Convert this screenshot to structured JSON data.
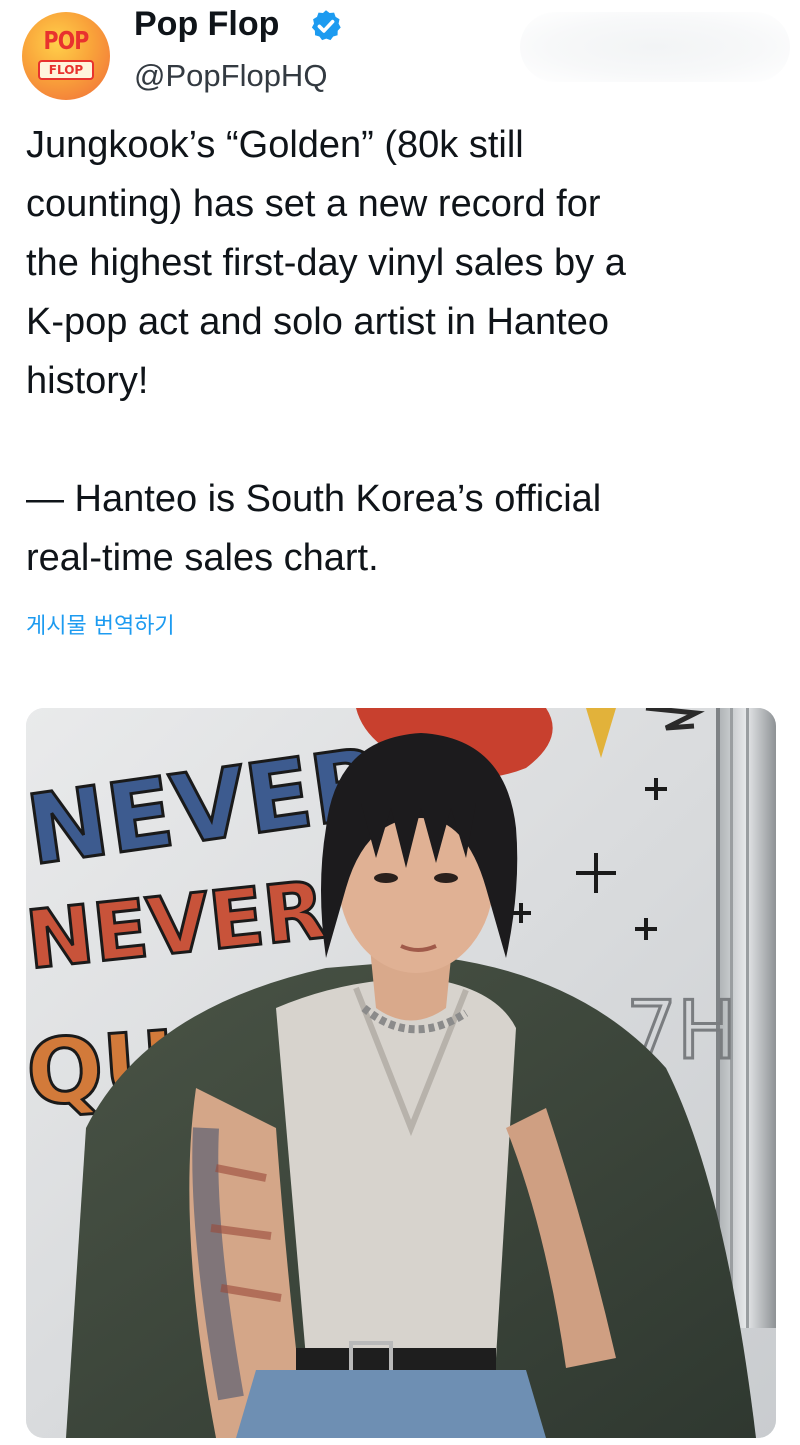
{
  "author": {
    "display_name": "Pop Flop",
    "handle": "@PopFlopHQ",
    "avatar_text_top": "POP",
    "avatar_text_bottom": "FLOP",
    "verified_color": "#1d9bf0"
  },
  "tweet": {
    "paragraph_1": "Jungkook’s “Golden” (80k still\ncounting) has set a new record for\nthe highest first-day vinyl sales by a\nK-pop act and solo artist in Hanteo\nhistory!",
    "paragraph_2": "— Hanteo is South Korea’s official\nreal-time sales chart.",
    "translate_label": "게시물 번역하기"
  },
  "media": {
    "graffiti_text_1": "NEVERS",
    "graffiti_text_2": "NEVER",
    "graffiti_text_3": "QUIT",
    "graffiti_text_4": "7H"
  },
  "colors": {
    "link": "#1d9bf0",
    "text": "#0f1419",
    "secondary_text": "#333a41"
  }
}
